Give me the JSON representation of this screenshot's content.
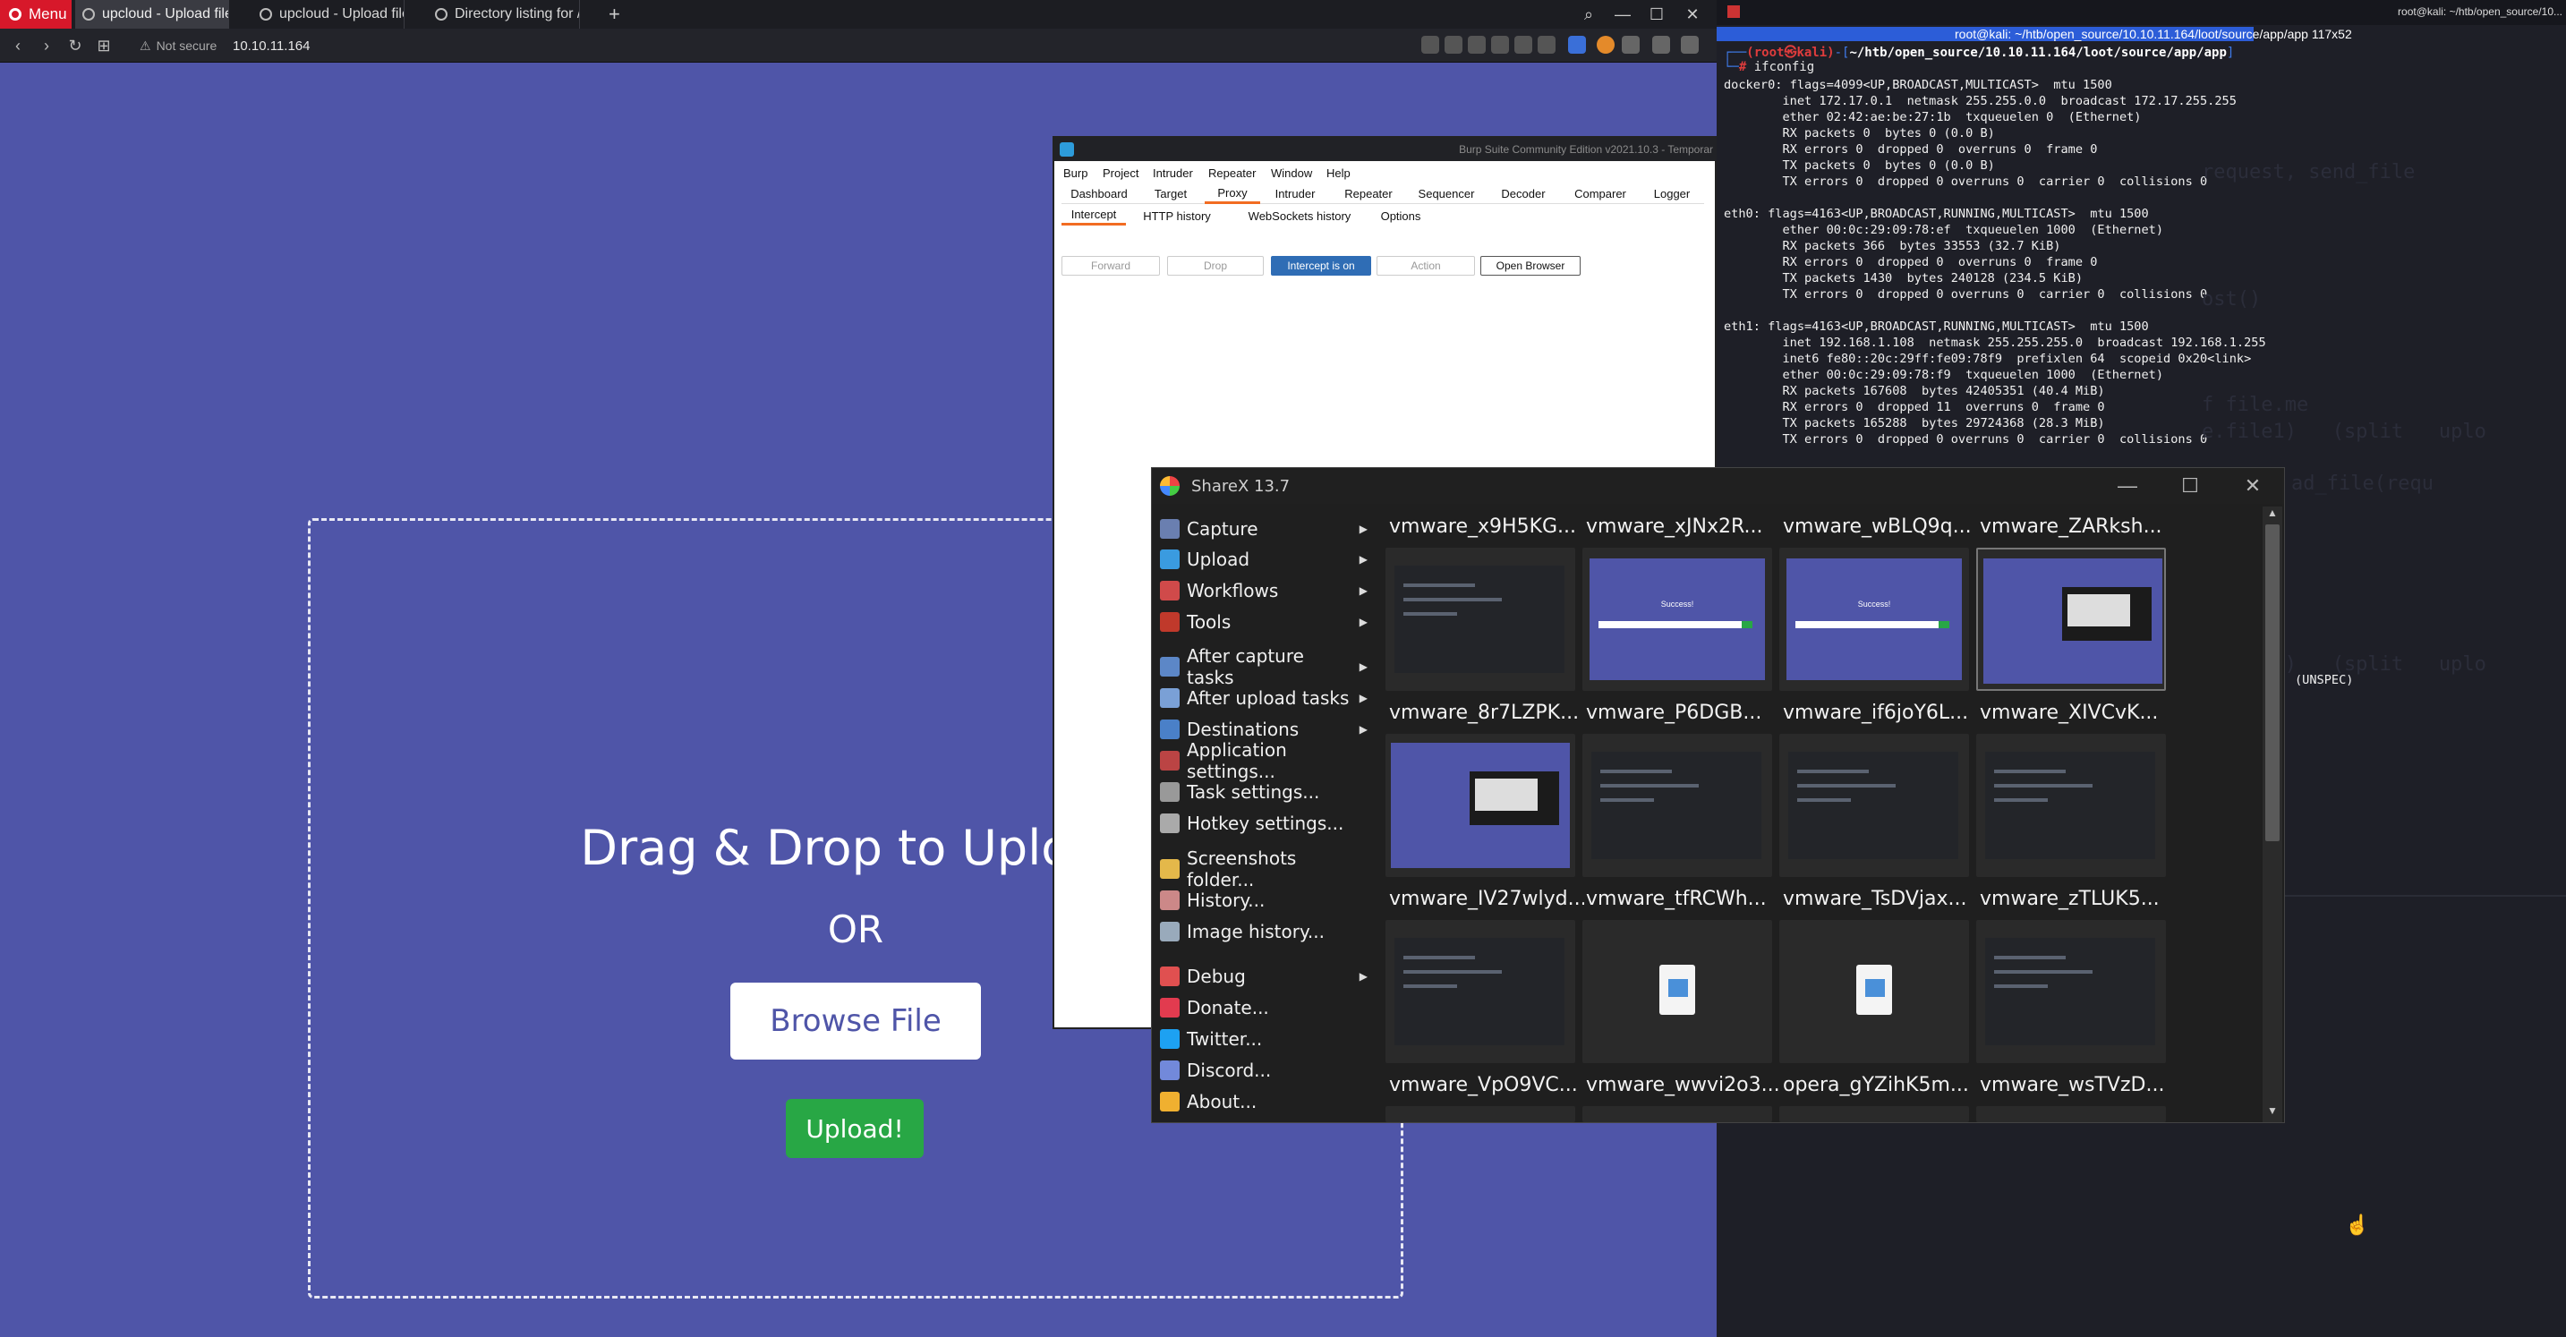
{
  "browser": {
    "menu_label": "Menu",
    "tabs": [
      {
        "label": "upcloud - Upload files",
        "active": true
      },
      {
        "label": "upcloud - Upload files",
        "active": false
      },
      {
        "label": "Directory listing for /",
        "active": false
      }
    ],
    "new_tab": "+",
    "security_label": "Not secure",
    "url": "10.10.11.164"
  },
  "upload_page": {
    "title": "Drag & Drop to Upload",
    "or_label": "OR",
    "browse_label": "Browse File",
    "upload_label": "Upload!",
    "bg_color": "#4f55a8",
    "upload_color": "#28a745"
  },
  "terminal": {
    "title": "root@kali: ~/htb/open_source/10.10.11.164/loot/source/app/app 117x52",
    "title_right": "root@kali: ~/htb/open_source/10...",
    "prompt_user": "(root㉿kali)",
    "prompt_path": "~/htb/open_source/10.10.11.164/loot/source/app/app",
    "command": "ifconfig",
    "output": "docker0: flags=4099<UP,BROADCAST,MULTICAST>  mtu 1500\n        inet 172.17.0.1  netmask 255.255.0.0  broadcast 172.17.255.255\n        ether 02:42:ae:be:27:1b  txqueuelen 0  (Ethernet)\n        RX packets 0  bytes 0 (0.0 B)\n        RX errors 0  dropped 0  overruns 0  frame 0\n        TX packets 0  bytes 0 (0.0 B)\n        TX errors 0  dropped 0 overruns 0  carrier 0  collisions 0\n\neth0: flags=4163<UP,BROADCAST,RUNNING,MULTICAST>  mtu 1500\n        ether 00:0c:29:09:78:ef  txqueuelen 1000  (Ethernet)\n        RX packets 366  bytes 33553 (32.7 KiB)\n        RX errors 0  dropped 0  overruns 0  frame 0\n        TX packets 1430  bytes 240128 (234.5 KiB)\n        TX errors 0  dropped 0 overruns 0  carrier 0  collisions 0\n\neth1: flags=4163<UP,BROADCAST,RUNNING,MULTICAST>  mtu 1500\n        inet 192.168.1.108  netmask 255.255.255.0  broadcast 192.168.1.255\n        inet6 fe80::20c:29ff:fe09:78f9  prefixlen 64  scopeid 0x20<link>\n        ether 00:0c:29:09:78:f9  txqueuelen 1000  (Ethernet)\n        RX packets 167608  bytes 42405351 (40.4 MiB)\n        RX errors 0  dropped 11  overruns 0  frame 0\n        TX packets 165288  bytes 29724368 (28.3 MiB)\n        TX errors 0  dropped 0 overruns 0  carrier 0  collisions 0",
    "unspec": "(UNSPEC)",
    "faint_lines": [
      "request, send_file",
      "ost()",
      "f file.me",
      "e.file1)   (split   uplo",
      "ad_file(requ",
      "n.file1)   (split   uplo"
    ]
  },
  "burp": {
    "title": "Burp Suite Community Edition v2021.10.3 - Temporar",
    "menu": [
      "Burp",
      "Project",
      "Intruder",
      "Repeater",
      "Window",
      "Help"
    ],
    "tabs": [
      "Dashboard",
      "Target",
      "Proxy",
      "Intruder",
      "Repeater",
      "Sequencer",
      "Decoder",
      "Comparer",
      "Logger"
    ],
    "active_tab": "Proxy",
    "subtabs": [
      "Intercept",
      "HTTP history",
      "WebSockets history",
      "Options"
    ],
    "buttons": {
      "forward": "Forward",
      "drop": "Drop",
      "intercept": "Intercept is on",
      "action": "Action",
      "open_browser": "Open Browser"
    }
  },
  "sharex": {
    "title": "ShareX 13.7",
    "menu": [
      {
        "label": "Capture",
        "icon": "capture-icon",
        "color": "#6a7fb0",
        "submenu": true
      },
      {
        "label": "Upload",
        "icon": "upload-arrow-icon",
        "color": "#3a9be0",
        "submenu": true
      },
      {
        "label": "Workflows",
        "icon": "workflows-icon",
        "color": "#d04a4a",
        "submenu": true
      },
      {
        "label": "Tools",
        "icon": "tools-icon",
        "color": "#c0392b",
        "submenu": true
      },
      {
        "label": "After capture tasks",
        "icon": "after-capture-icon",
        "color": "#5c87c7",
        "submenu": true
      },
      {
        "label": "After upload tasks",
        "icon": "after-upload-icon",
        "color": "#7aa0d6",
        "submenu": true
      },
      {
        "label": "Destinations",
        "icon": "destinations-icon",
        "color": "#4a80c8",
        "submenu": true
      },
      {
        "label": "Application settings...",
        "icon": "app-settings-icon",
        "color": "#b44",
        "submenu": false
      },
      {
        "label": "Task settings...",
        "icon": "task-settings-icon",
        "color": "#999",
        "submenu": false
      },
      {
        "label": "Hotkey settings...",
        "icon": "hotkey-settings-icon",
        "color": "#aaa",
        "submenu": false
      },
      {
        "label": "Screenshots folder...",
        "icon": "folder-icon",
        "color": "#e4b84a",
        "submenu": false
      },
      {
        "label": "History...",
        "icon": "history-icon",
        "color": "#c88",
        "submenu": false
      },
      {
        "label": "Image history...",
        "icon": "image-history-icon",
        "color": "#9ab",
        "submenu": false
      },
      {
        "label": "Debug",
        "icon": "debug-icon",
        "color": "#e05050",
        "submenu": true
      },
      {
        "label": "Donate...",
        "icon": "heart-icon",
        "color": "#e23b4f",
        "submenu": false
      },
      {
        "label": "Twitter...",
        "icon": "twitter-icon",
        "color": "#1da1f2",
        "submenu": false
      },
      {
        "label": "Discord...",
        "icon": "discord-icon",
        "color": "#7289da",
        "submenu": false
      },
      {
        "label": "About...",
        "icon": "crown-icon",
        "color": "#f0b030",
        "submenu": false
      }
    ],
    "grid": [
      [
        "vmware_x9H5KG...",
        "vmware_xJNx2R...",
        "vmware_wBLQ9q...",
        "vmware_ZARksh..."
      ],
      [
        "vmware_8r7LZPK...",
        "vmware_P6DGB...",
        "vmware_if6joY6L...",
        "vmware_XIVCvK..."
      ],
      [
        "vmware_IV27wlyd...",
        "vmware_tfRCWh...",
        "vmware_TsDVjax...",
        "vmware_zTLUK5..."
      ],
      [
        "vmware_VpO9VC...",
        "vmware_wwvi2o3...",
        "opera_gYZihK5m...",
        "vmware_wsTVzD..."
      ]
    ],
    "thumb_success_text": "Success!"
  }
}
